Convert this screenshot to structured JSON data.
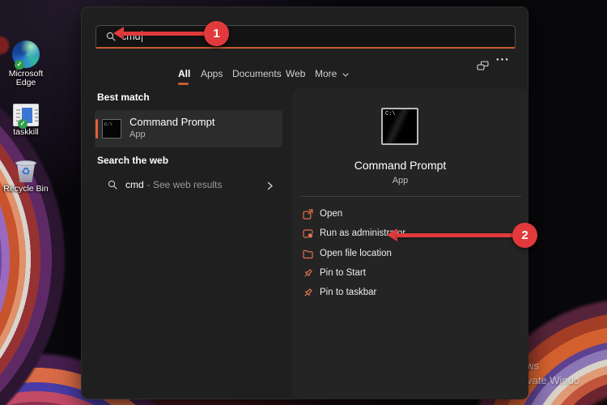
{
  "desktop": {
    "icons": [
      {
        "label": "Microsoft Edge"
      },
      {
        "label": "taskkill"
      },
      {
        "label": "Recycle Bin"
      }
    ],
    "watermark": {
      "line1": "ws",
      "line2": "vate Windo"
    }
  },
  "search_panel": {
    "search_box": {
      "value": "cmd"
    },
    "tabs": [
      {
        "label": "All"
      },
      {
        "label": "Apps"
      },
      {
        "label": "Documents"
      },
      {
        "label": "Web"
      },
      {
        "label": "More"
      }
    ],
    "header": {
      "ellipsis": "●●●"
    },
    "left_pane": {
      "best_match_label": "Best match",
      "best_match": {
        "title": "Command Prompt",
        "subtitle": "App",
        "icon_text": "C:\\"
      },
      "web_label": "Search the web",
      "web_result": {
        "query": "cmd",
        "suffix": "- See web results"
      }
    },
    "preview_pane": {
      "icon_text": "C:\\",
      "title": "Command Prompt",
      "subtitle": "App",
      "actions": [
        {
          "label": "Open"
        },
        {
          "label": "Run as administrator"
        },
        {
          "label": "Open file location"
        },
        {
          "label": "Pin to Start"
        },
        {
          "label": "Pin to taskbar"
        }
      ]
    }
  },
  "annotations": {
    "step1": "1",
    "step2": "2"
  },
  "colors": {
    "accent": "#c85a32",
    "action_icon": "#e0704c",
    "annotation_red": "#e23a3c",
    "panel_bg": "#1f1f1f",
    "preview_bg": "#242424",
    "selected_bg": "#2c2c2c"
  }
}
